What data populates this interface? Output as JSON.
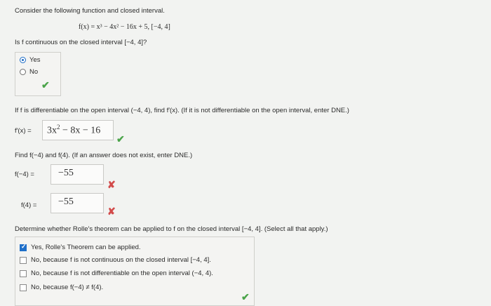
{
  "intro": "Consider the following function and closed interval.",
  "function_text": "f(x) = x³ − 4x² − 16x + 5,   [−4, 4]",
  "q1": {
    "prompt": "Is f continuous on the closed interval [−4, 4]?",
    "options": [
      "Yes",
      "No"
    ],
    "selected": "Yes"
  },
  "q2": {
    "prompt": "If f is differentiable on the open interval (−4, 4), find f′(x). (If it is not differentiable on the open interval, enter DNE.)",
    "label": "f′(x) =",
    "answer_parts": {
      "coef": "3x",
      "exp": "2",
      "rest": " − 8x − 16"
    }
  },
  "q3": {
    "prompt": "Find f(−4) and f(4). (If an answer does not exist, enter DNE.)",
    "label_a": "f(−4) =",
    "value_a": "−55",
    "label_b": "f(4) =",
    "value_b": "−55"
  },
  "q4": {
    "prompt": "Determine whether Rolle's theorem can be applied to f on the closed interval [−4, 4]. (Select all that apply.)",
    "options": [
      "Yes, Rolle's Theorem can be applied.",
      "No, because f is not continuous on the closed interval [−4, 4].",
      "No, because f is not differentiable on the open interval (−4, 4).",
      "No, because f(−4) ≠ f(4)."
    ],
    "checked": [
      true,
      false,
      false,
      false
    ]
  },
  "marks": {
    "correct": "✔",
    "incorrect": "✘"
  }
}
